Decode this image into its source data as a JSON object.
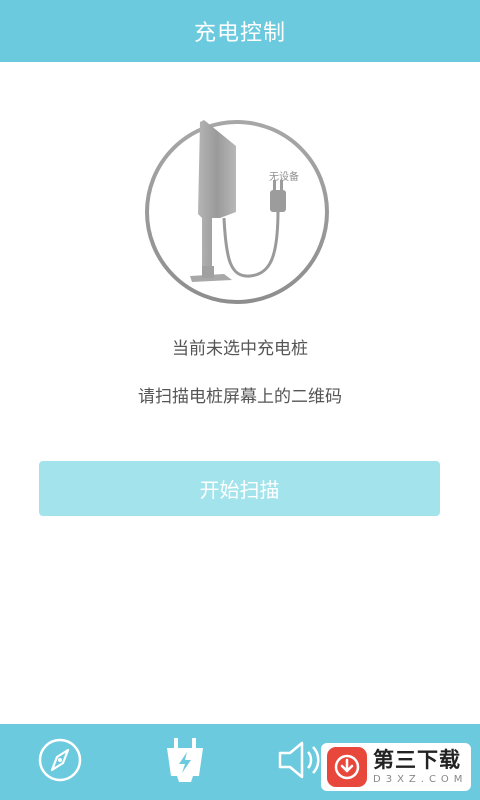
{
  "header": {
    "title": "充电控制"
  },
  "illustration": {
    "device_status": "无设备"
  },
  "message": {
    "line1": "当前未选中充电桩",
    "line2": "请扫描电桩屏幕上的二维码"
  },
  "scan_button": {
    "label": "开始扫描"
  },
  "tabbar": {
    "tabs": [
      {
        "name": "discover",
        "icon": "compass-icon"
      },
      {
        "name": "charge",
        "icon": "charging-plug-icon"
      },
      {
        "name": "sound",
        "icon": "speaker-icon"
      }
    ]
  },
  "watermark": {
    "main": "第三下载",
    "sub": "D3XZ.COM"
  },
  "colors": {
    "primary": "#6ccadf",
    "button": "#a2e3ec",
    "text": "#555555",
    "watermark_logo": "#e8483b"
  }
}
